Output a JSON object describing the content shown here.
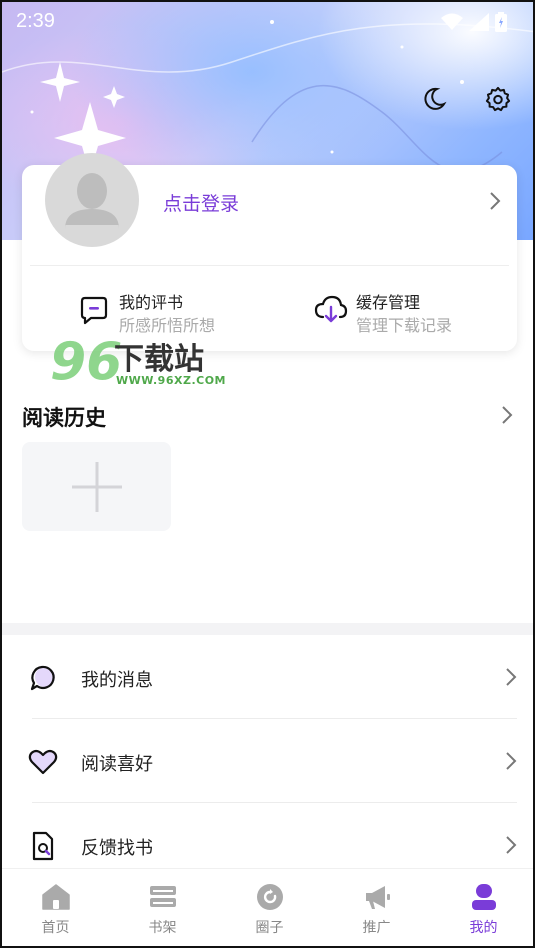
{
  "status": {
    "time": "2:39"
  },
  "header": {
    "night_mode_icon": "moon-icon",
    "settings_icon": "gear-icon"
  },
  "profile": {
    "login_label": "点击登录"
  },
  "quick_actions": [
    {
      "title": "我的评书",
      "subtitle": "所感所悟所想",
      "icon": "comment-icon"
    },
    {
      "title": "缓存管理",
      "subtitle": "管理下载记录",
      "icon": "cloud-download-icon"
    }
  ],
  "watermark": {
    "number": "96",
    "name": "下载站",
    "url": "WWW.96XZ.COM"
  },
  "reading_history": {
    "title": "阅读历史"
  },
  "menu": [
    {
      "label": "我的消息",
      "icon": "message-icon"
    },
    {
      "label": "阅读喜好",
      "icon": "heart-icon"
    },
    {
      "label": "反馈找书",
      "icon": "search-book-icon"
    }
  ],
  "tabs": [
    {
      "label": "首页",
      "icon": "home-icon",
      "active": false
    },
    {
      "label": "书架",
      "icon": "bookshelf-icon",
      "active": false
    },
    {
      "label": "圈子",
      "icon": "circle-icon",
      "active": false
    },
    {
      "label": "推广",
      "icon": "megaphone-icon",
      "active": false
    },
    {
      "label": "我的",
      "icon": "user-icon",
      "active": true
    }
  ],
  "colors": {
    "accent": "#7a3cd8",
    "inactive_tab": "#888888"
  }
}
